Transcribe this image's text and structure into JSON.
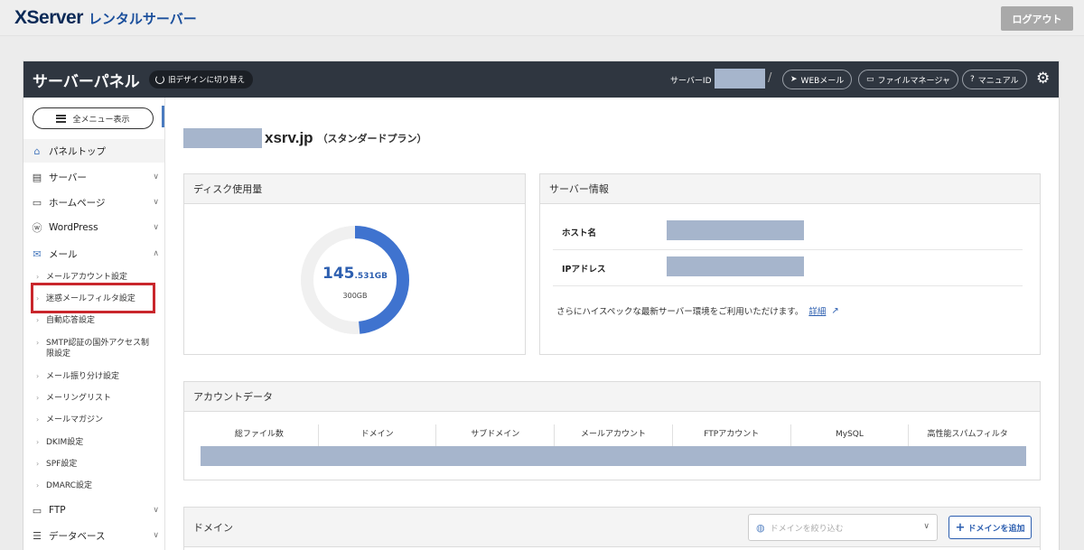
{
  "topbar": {
    "logo_main": "XServer",
    "logo_sub": "レンタルサーバー",
    "logout_label": "ログアウト"
  },
  "header": {
    "title": "サーバーパネル",
    "old_design_label": "旧デザインに切り替え",
    "server_id_label": "サーバーID",
    "buttons": {
      "webmail": "WEBメール",
      "file_manager": "ファイルマネージャ",
      "manual": "マニュアル"
    }
  },
  "sidebar": {
    "all_menu_label": "全メニュー表示",
    "items": [
      {
        "label": "パネルトップ",
        "icon": "home-icon"
      },
      {
        "label": "サーバー",
        "icon": "server-icon"
      },
      {
        "label": "ホームページ",
        "icon": "window-icon"
      },
      {
        "label": "WordPress",
        "icon": "wordpress-icon"
      },
      {
        "label": "メール",
        "icon": "mail-icon"
      },
      {
        "label": "FTP",
        "icon": "monitor-icon"
      },
      {
        "label": "データベース",
        "icon": "database-icon"
      }
    ],
    "mail_sub": [
      "メールアカウント設定",
      "迷惑メールフィルタ設定",
      "自動応答設定",
      "SMTP認証の国外アクセス制限設定",
      "メール振り分け設定",
      "メーリングリスト",
      "メールマガジン",
      "DKIM設定",
      "SPF設定",
      "DMARC設定"
    ],
    "highlighted_item": "迷惑メールフィルタ設定"
  },
  "main": {
    "domain_suffix": "xsrv.jp",
    "plan": "（スタンダードプラン）",
    "disk": {
      "title": "ディスク使用量",
      "used_value": "145",
      "used_decimal": ".531GB",
      "total": "300GB",
      "used_fraction": 0.4851,
      "colors": {
        "used": "#3f73cf",
        "track": "#f0f0f0"
      }
    },
    "server_info": {
      "title": "サーバー情報",
      "rows": [
        {
          "label": "ホスト名"
        },
        {
          "label": "IPアドレス"
        }
      ],
      "note": "さらにハイスペックな最新サーバー環境をご利用いただけます。",
      "link_label": "詳細"
    },
    "account_data": {
      "title": "アカウントデータ",
      "columns": [
        "総ファイル数",
        "ドメイン",
        "サブドメイン",
        "メールアカウント",
        "FTPアカウント",
        "MySQL",
        "高性能スパムフィルタ"
      ]
    },
    "domains": {
      "title": "ドメイン",
      "filter_placeholder": "ドメインを絞り込む",
      "add_label": "ドメインを追加"
    }
  }
}
